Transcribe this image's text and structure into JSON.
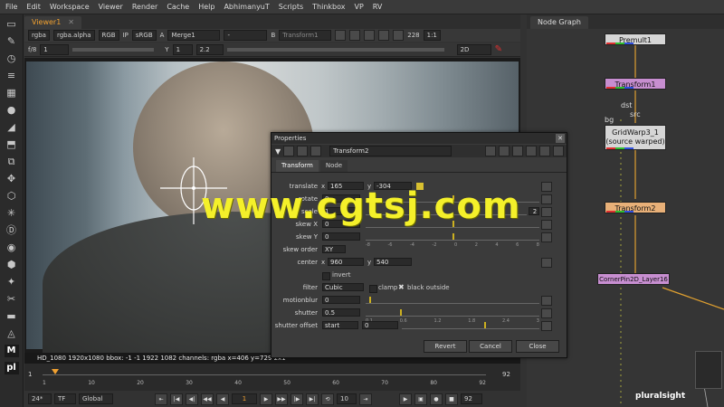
{
  "menu": [
    "File",
    "Edit",
    "Workspace",
    "Viewer",
    "Render",
    "Cache",
    "Help",
    "AbhimanyuT",
    "Scripts",
    "Thinkbox",
    "VP",
    "RV"
  ],
  "viewer": {
    "tab": "Viewer1",
    "channels": "rgba",
    "alpha": "rgba.alpha",
    "rgb": "RGB",
    "ip": "IP",
    "colorspace": "sRGB",
    "a_label": "A",
    "a_input": "Merge1",
    "a_dash": "-",
    "b_label": "B",
    "b_input": "Transform1",
    "zoom": "1:1",
    "zoom_pct": "228",
    "fstop": "f/8",
    "frame_field": "1",
    "y_label": "Y",
    "y_value": "1",
    "gain": "2.2",
    "view_mode": "2D",
    "status": "HD_1080 1920x1080  bbox: -1 -1 1922 1082 channels: rgba  x=406 y=729 2x1"
  },
  "timeline": {
    "start": "1",
    "ticks": [
      "1",
      "10",
      "20",
      "30",
      "40",
      "50",
      "60",
      "70",
      "80",
      "92"
    ],
    "end": "92",
    "current": "1",
    "fps": "24*",
    "tf": "TF",
    "global": "Global",
    "step": "10",
    "end_field": "92"
  },
  "node_graph": {
    "tab": "Node Graph",
    "nodes": [
      {
        "name": "Premult1",
        "color": "#d6d6d6"
      },
      {
        "name": "Transform1",
        "color": "#c78ed0"
      },
      {
        "name": "GridWarp3_1\n(source warped)",
        "color": "#d6d6d6"
      },
      {
        "name": "Transform2",
        "color": "#e8b078"
      },
      {
        "name": "CornerPin2D_Layer16",
        "color": "#c78ed0"
      }
    ],
    "labels": [
      "dst",
      "src",
      "bg"
    ]
  },
  "properties": {
    "title": "Properties",
    "node_name": "Transform2",
    "tabs": [
      "Transform",
      "Node"
    ],
    "rows": [
      {
        "label": "translate",
        "x_label": "x",
        "x": "165",
        "y_label": "y",
        "y": "-304"
      },
      {
        "label": "rotate",
        "value": "0"
      },
      {
        "label": "scale",
        "value": "1",
        "extra": "2"
      },
      {
        "label": "skew X",
        "value": "0"
      },
      {
        "label": "skew Y",
        "value": "0"
      },
      {
        "label": "skew order",
        "value": "XY"
      },
      {
        "label": "center",
        "x_label": "x",
        "x": "960",
        "y_label": "y",
        "y": "540"
      },
      {
        "label": "invert"
      },
      {
        "label": "filter",
        "value": "Cubic",
        "clamp": "clamp",
        "black": "black outside"
      },
      {
        "label": "motionblur",
        "value": "0"
      },
      {
        "label": "shutter",
        "value": "0.5"
      },
      {
        "label": "shutter offset",
        "value": "start",
        "offset": "0"
      }
    ],
    "slider_ticks": [
      "-8",
      "-6",
      "-4",
      "-2",
      "0",
      "2",
      "4",
      "6",
      "8"
    ],
    "slider_ticks2": [
      "0.1",
      "0.6",
      "1.2",
      "1.8",
      "2.4",
      "3"
    ],
    "buttons": {
      "revert": "Revert",
      "cancel": "Cancel",
      "close": "Close"
    }
  },
  "watermark": "www.cgtsj.com",
  "brand": "pluralsight"
}
